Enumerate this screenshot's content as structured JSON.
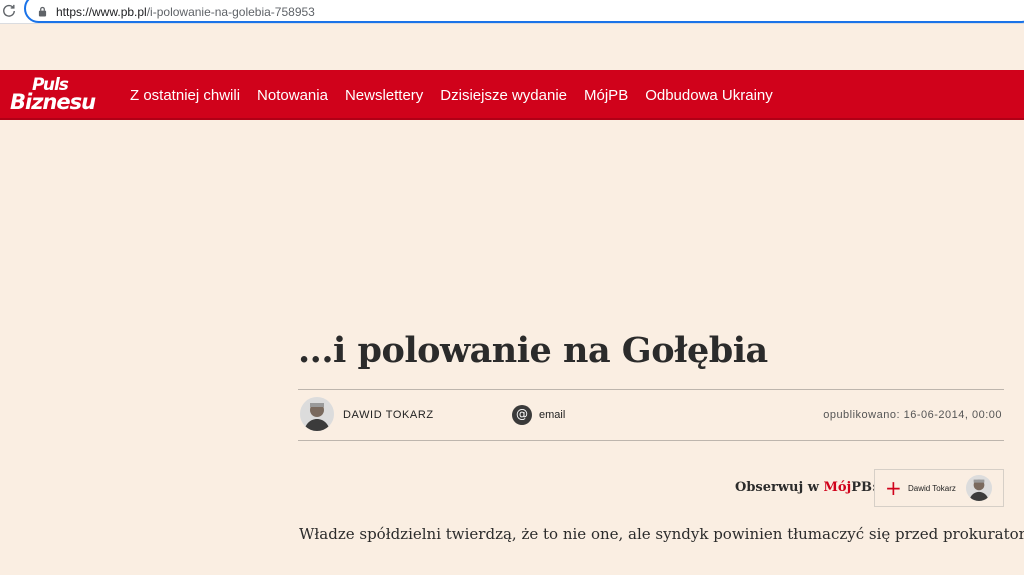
{
  "browser": {
    "url_host": "https://www.pb.pl",
    "url_path": "/i-polowanie-na-golebia-758953"
  },
  "header": {
    "logo_line1": "Puls",
    "logo_line2": "Biznesu",
    "nav": [
      {
        "label": "Z ostatniej chwili"
      },
      {
        "label": "Notowania"
      },
      {
        "label": "Newslettery"
      },
      {
        "label": "Dzisiejsze wydanie"
      },
      {
        "label": "MójPB"
      },
      {
        "label": "Odbudowa Ukrainy"
      }
    ],
    "colors": {
      "brand": "#d0021b",
      "background": "#faeee2"
    }
  },
  "article": {
    "title": "...i polowanie na Gołębia",
    "author": "DAWID TOKARZ",
    "email_icon": "@",
    "email_label": "email",
    "published": "opublikowano: 16-06-2014, 00:00",
    "follow_prefix": "Obserwuj w ",
    "follow_brand_moj": "Mój",
    "follow_brand_pb": "PB:",
    "follow_plus": "+",
    "follow_author": "Dawid Tokarz",
    "lead": "Władze spółdzielni twierdzą, że to nie one, ale syndyk powinien tłumaczyć się przed prokuratorem."
  }
}
